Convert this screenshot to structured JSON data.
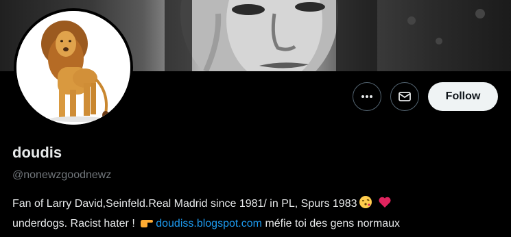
{
  "profile": {
    "display_name": "doudis",
    "handle": "@nonewzgoodnewz",
    "bio_line1": "Fan of Larry David,Seinfeld.Real Madrid since 1981/ in PL, Spurs 1983",
    "bio_line2_start": "underdogs. Racist hater !",
    "bio_link": "doudiss.blogspot.com",
    "bio_line2_end": "méfie toi des gens normaux"
  },
  "actions": {
    "more_icon": "more-dots-icon",
    "message_icon": "envelope-icon",
    "follow_label": "Follow"
  },
  "icons": {
    "emoji_kiss": "face-blowing-kiss-emoji",
    "emoji_heart": "red-heart-emoji",
    "emoji_point": "pointing-right-hand-emoji"
  },
  "colors": {
    "background": "#000000",
    "text_primary": "#e7e9ea",
    "text_secondary": "#71767b",
    "link": "#1d9bf0",
    "button_border": "#536471",
    "follow_bg": "#eff3f4",
    "follow_text": "#0f1419",
    "heart": "#e0245e"
  }
}
